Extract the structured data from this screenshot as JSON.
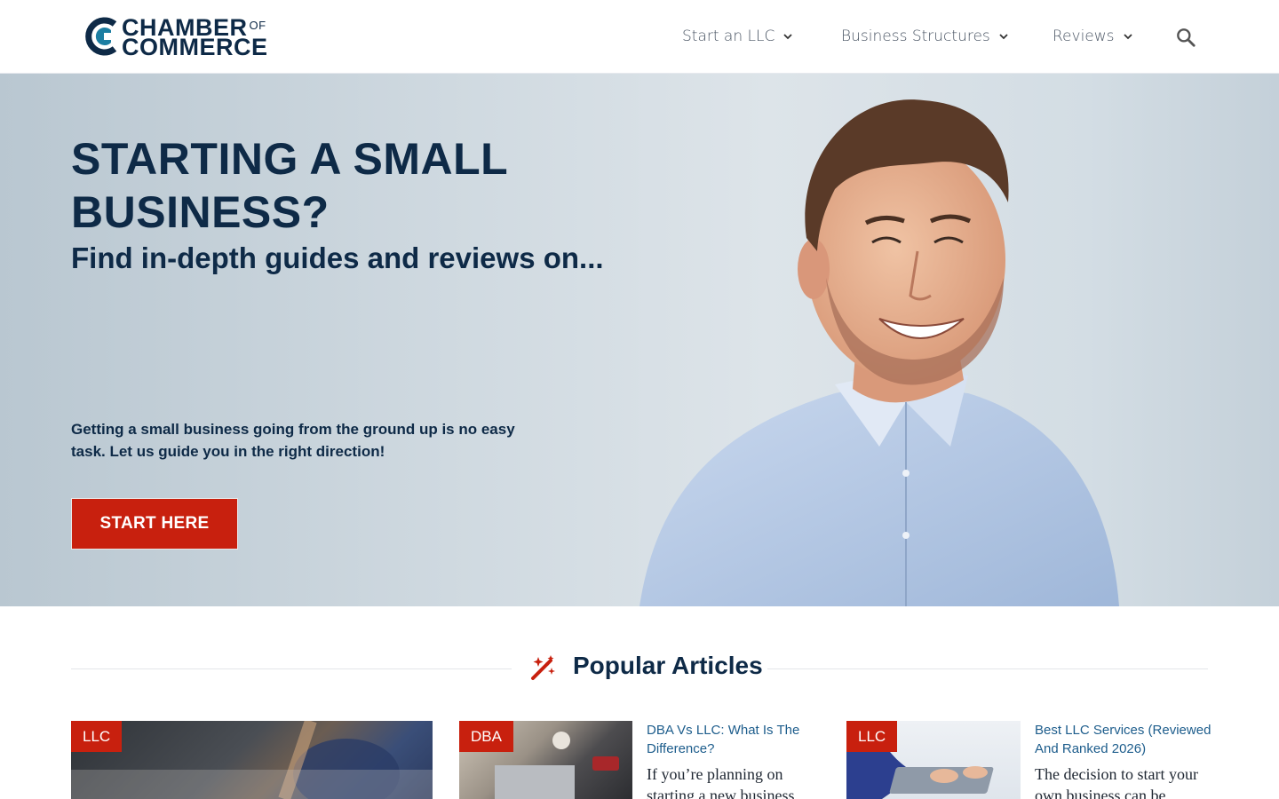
{
  "header": {
    "logo": {
      "line1": "CHAMBER",
      "of": "OF",
      "line2": "COMMERCE"
    },
    "nav": [
      {
        "label": "Start an LLC"
      },
      {
        "label": "Business Structures"
      },
      {
        "label": "Reviews"
      }
    ],
    "search_icon": "search-icon"
  },
  "hero": {
    "title": "STARTING A SMALL BUSINESS?",
    "subtitle": "Find in-depth guides and reviews on...",
    "body": "Getting a small business going from the ground up is no easy task. Let us guide you in the right direction!",
    "cta": "START HERE"
  },
  "popular": {
    "title": "Popular Articles",
    "icon": "magic-wand-icon",
    "cards": [
      {
        "tag": "LLC",
        "title": "",
        "excerpt": ""
      },
      {
        "tag": "DBA",
        "title": "DBA Vs LLC: What Is The Difference?",
        "excerpt": "If you’re planning on starting a new business"
      },
      {
        "tag": "LLC",
        "title": "Best LLC Services (Reviewed And Ranked 2026)",
        "excerpt": "The decision to start your own business can be"
      }
    ]
  },
  "colors": {
    "navy": "#0e2a47",
    "accent_red": "#c8200e",
    "link_blue": "#1d5d8c"
  }
}
